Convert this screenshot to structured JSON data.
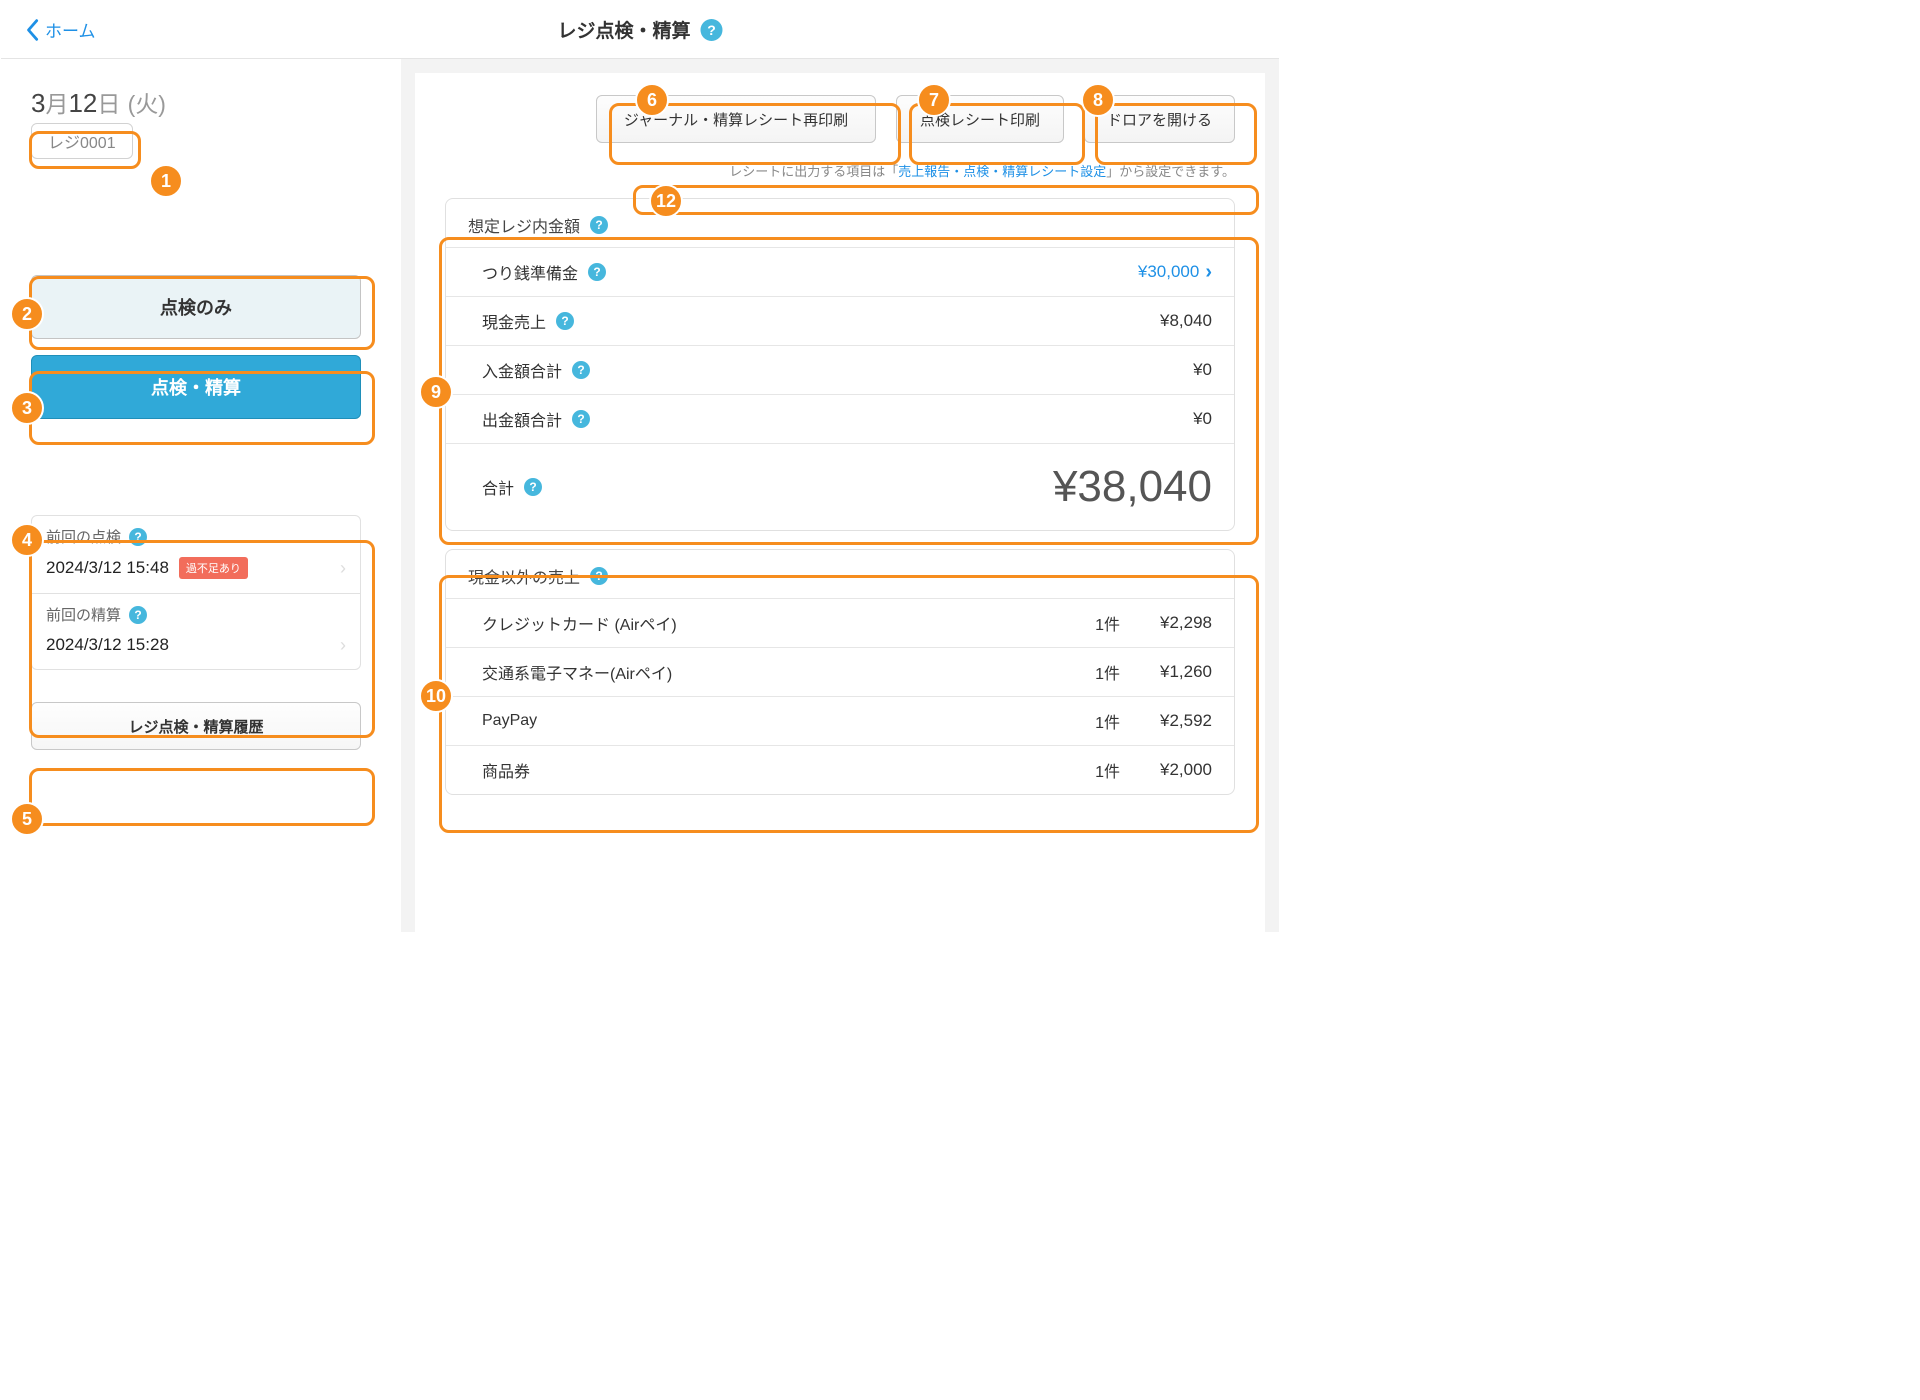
{
  "header": {
    "back": "ホーム",
    "title": "レジ点検・精算"
  },
  "sidebar": {
    "date_prefix": "3",
    "date_mid": "月",
    "date_day": "12",
    "date_suffix": "日",
    "date_weekday": "(火)",
    "register_label": "レジ0001",
    "btn_check_only": "点検のみ",
    "btn_check_close": "点検・精算",
    "prev_check_label": "前回の点検",
    "prev_check_time": "2024/3/12 15:48",
    "prev_check_badge": "過不足あり",
    "prev_close_label": "前回の精算",
    "prev_close_time": "2024/3/12 15:28",
    "btn_history": "レジ点検・精算履歴"
  },
  "topActions": {
    "reprint": "ジャーナル・精算レシート再印刷",
    "print_check": "点検レシート印刷",
    "open_drawer": "ドロアを開ける"
  },
  "note": {
    "pre": "レシートに出力する項目は「",
    "link": "売上報告・点検・精算レシート設定",
    "post": "」から設定できます。"
  },
  "expected": {
    "title": "想定レジ内金額",
    "float_label": "つり銭準備金",
    "float_value": "¥30,000",
    "cash_label": "現金売上",
    "cash_value": "¥8,040",
    "deposit_label": "入金額合計",
    "deposit_value": "¥0",
    "withdraw_label": "出金額合計",
    "withdraw_value": "¥0",
    "total_label": "合計",
    "total_value": "¥38,040"
  },
  "noncash": {
    "title": "現金以外の売上",
    "rows": [
      {
        "label": "クレジットカード (Airペイ)",
        "count": "1件",
        "value": "¥2,298"
      },
      {
        "label": "交通系電子マネー(Airペイ)",
        "count": "1件",
        "value": "¥1,260"
      },
      {
        "label": "PayPay",
        "count": "1件",
        "value": "¥2,592"
      },
      {
        "label": "商品券",
        "count": "1件",
        "value": "¥2,000"
      }
    ]
  },
  "callouts": {
    "n1": "1",
    "n2": "2",
    "n3": "3",
    "n4": "4",
    "n5": "5",
    "n6": "6",
    "n7": "7",
    "n8": "8",
    "n9": "9",
    "n10": "10",
    "n12": "12"
  }
}
